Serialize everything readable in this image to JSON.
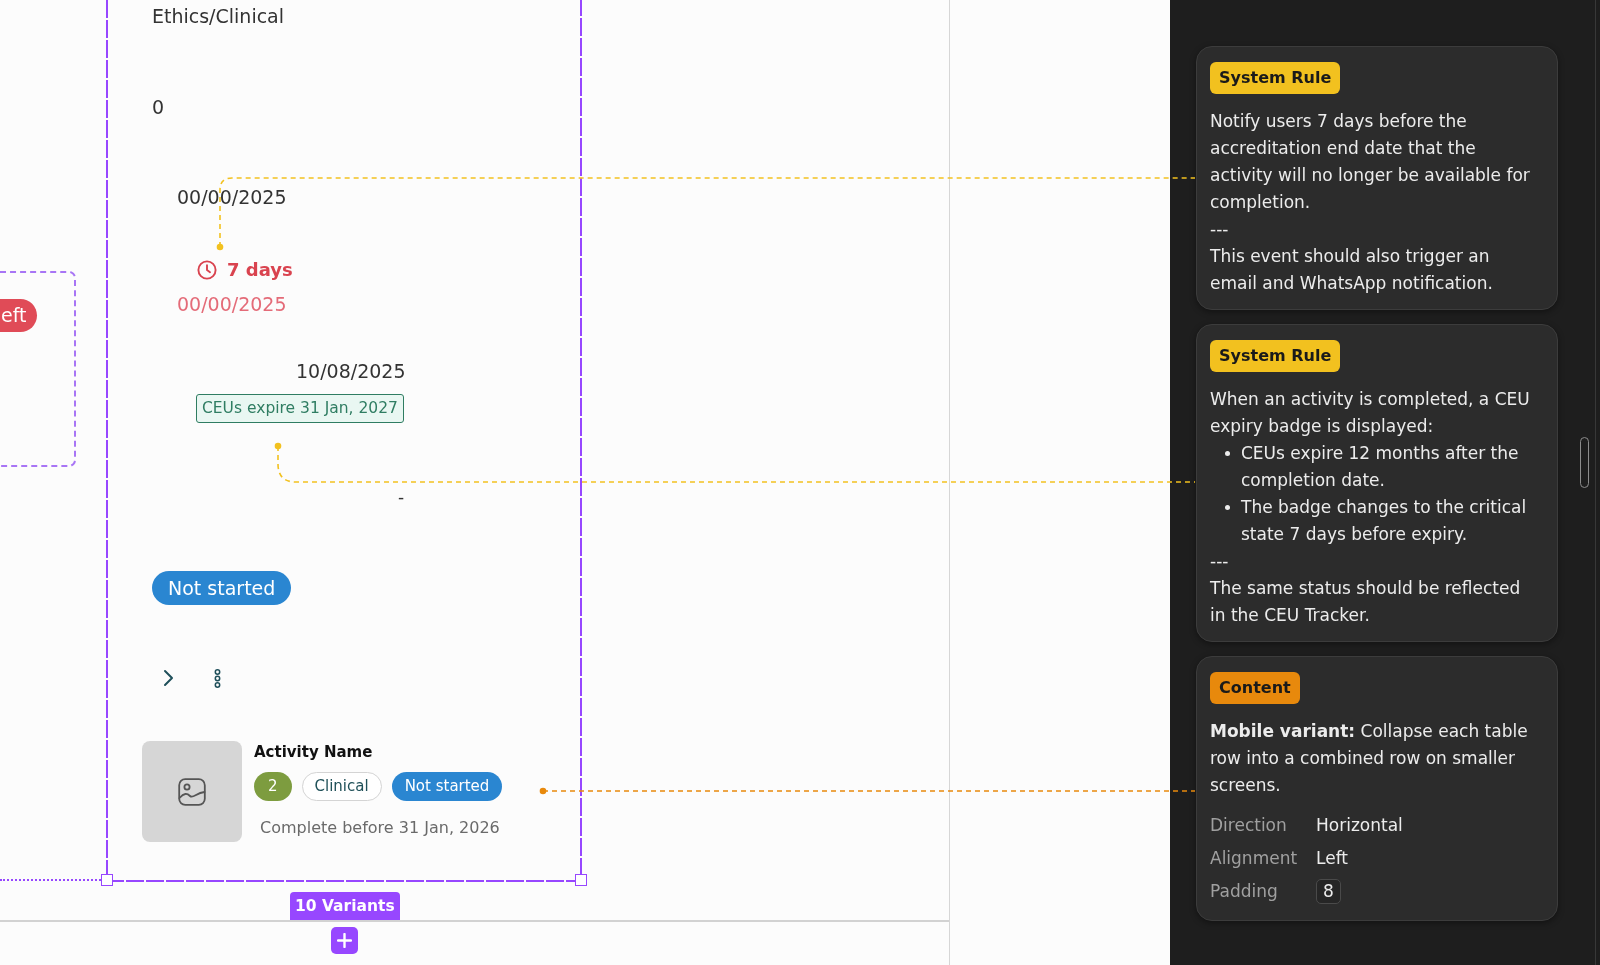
{
  "canvas": {
    "partial_variant": {
      "pill": "eft"
    },
    "variants": {
      "category": "Ethics/Clinical",
      "credits": "0",
      "start_date": "00/00/2025",
      "deadline": {
        "critical": true,
        "countdown": "7 days",
        "date": "00/00/2025"
      },
      "completion": {
        "date": "10/08/2025",
        "expiry_badge": "CEUs expire 31 Jan, 2027"
      },
      "empty_value": "-",
      "status": "Not started",
      "mobile_row": {
        "title": "Activity Name",
        "tags": [
          {
            "label": "2",
            "kind": "count"
          },
          {
            "label": "Clinical",
            "kind": "category"
          },
          {
            "label": "Not started",
            "kind": "status"
          }
        ],
        "due_text": "Complete before 31 Jan, 2026"
      },
      "count_label": "10 Variants"
    }
  },
  "annotations": [
    {
      "tag": "System Rule",
      "color": "#f2c11f",
      "blocks": [
        {
          "kind": "text",
          "text": "Notify users 7 days before the accreditation end date that the activity will no longer be available for completion."
        },
        {
          "kind": "text",
          "text": "---"
        },
        {
          "kind": "text",
          "text": "This event should also trigger an email and WhatsApp notification."
        }
      ]
    },
    {
      "tag": "System Rule",
      "color": "#f2c11f",
      "blocks": [
        {
          "kind": "text",
          "text": "When an activity is completed, a CEU expiry badge is displayed:"
        },
        {
          "kind": "list",
          "items": [
            "CEUs expire 12 months after the completion date.",
            "The badge changes to the critical state 7 days before expiry."
          ]
        },
        {
          "kind": "text",
          "text": "---"
        },
        {
          "kind": "text",
          "text": "The same status should be reflected in the CEU Tracker."
        }
      ]
    },
    {
      "tag": "Content",
      "color": "#e8890c",
      "blocks": [
        {
          "kind": "text",
          "text": "**Mobile variant:** Collapse each table row into a combined row on smaller screens."
        },
        {
          "kind": "properties",
          "rows": [
            {
              "label": "Direction",
              "value": "Horizontal",
              "boxed": false
            },
            {
              "label": "Alignment",
              "value": "Left",
              "boxed": false
            },
            {
              "label": "Padding",
              "value": "8",
              "boxed": true
            }
          ]
        }
      ]
    }
  ]
}
